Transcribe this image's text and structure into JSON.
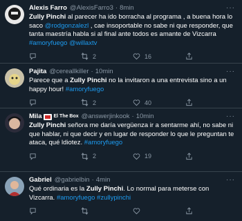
{
  "tweets": [
    {
      "name": "Alexis Farro",
      "handle": "@AlexisFarro3",
      "dot": "·",
      "time": "8min",
      "body": [
        {
          "t": "Zully Pinchi",
          "s": "bold"
        },
        {
          "t": " al parecer  ha ido borracha al programa , a buena hora lo saco ",
          "s": "text"
        },
        {
          "t": "@rodgonzalezl",
          "s": "link"
        },
        {
          "t": " , cae insoportable no sabe ni que responder, que tanta maestría habla si al final ante todos es amante de Vizcarra ",
          "s": "text"
        },
        {
          "t": "#amoryfuego",
          "s": "link"
        },
        {
          "t": " ",
          "s": "text"
        },
        {
          "t": "@willaxtv",
          "s": "link"
        }
      ],
      "reply_count": "",
      "retweet_count": "2",
      "like_count": "16"
    },
    {
      "name": "Pajita",
      "handle": "@cereallkiller",
      "dot": "·",
      "time": "10min",
      "body": [
        {
          "t": "Parece que a ",
          "s": "text"
        },
        {
          "t": "Zully Pinchi",
          "s": "bold"
        },
        {
          "t": " no la invitaron a una entrevista sino a un happy hour! ",
          "s": "text"
        },
        {
          "t": "#amoryfuego",
          "s": "link"
        }
      ],
      "reply_count": "",
      "retweet_count": "2",
      "like_count": "40"
    },
    {
      "name": "Mila",
      "badge_text": "El The Box",
      "handle": "@answerjinkook",
      "dot": "·",
      "time": "10min",
      "body": [
        {
          "t": "Zully Pinchi",
          "s": "bold"
        },
        {
          "t": " señora me daría vergüenza ir a sentarme ahí, no sabe ni que hablar, ni que decir y en lugar de responder lo que le preguntan te ataca, qué ldiotez. ",
          "s": "text"
        },
        {
          "t": "#amoryfuego",
          "s": "link"
        }
      ],
      "reply_count": "",
      "retweet_count": "2",
      "like_count": "19"
    },
    {
      "name": "Gabriel",
      "handle": "@gabrielbin",
      "dot": "·",
      "time": "4min",
      "body": [
        {
          "t": "Qué ordinaria es la ",
          "s": "text"
        },
        {
          "t": "Zully Pinchi",
          "s": "bold"
        },
        {
          "t": ". Lo normal para meterse con Vizcarra. ",
          "s": "text"
        },
        {
          "t": "#amoryfuego",
          "s": "link"
        },
        {
          "t": " ",
          "s": "text"
        },
        {
          "t": "#zullypinchi",
          "s": "link"
        }
      ],
      "reply_count": "",
      "retweet_count": "",
      "like_count": ""
    }
  ],
  "icons": {
    "reply": "reply-icon",
    "retweet": "retweet-icon",
    "like": "heart-icon",
    "share": "share-icon"
  },
  "colors": {
    "background": "#15202b",
    "link": "#1d9bf0",
    "muted": "#8b98a5",
    "divider": "#38444d"
  }
}
